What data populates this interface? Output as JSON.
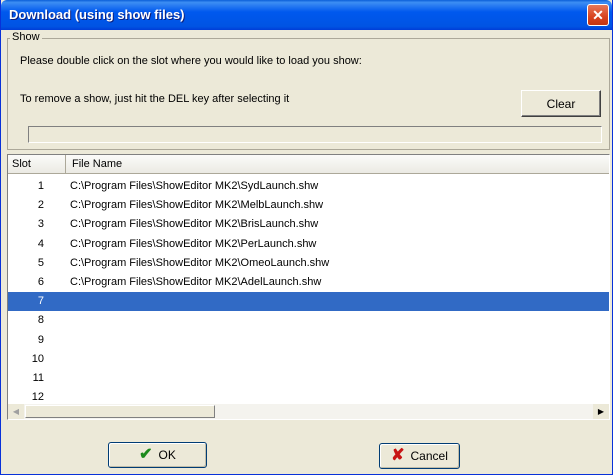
{
  "window": {
    "title": "Download (using show files)"
  },
  "show_group": {
    "legend": "Show",
    "instruction_load": "Please double click on the slot where you would like to load you show:",
    "instruction_remove": "To remove a show, just hit the DEL key after selecting it",
    "clear_label": "Clear"
  },
  "list": {
    "columns": {
      "slot": "Slot",
      "file": "File Name"
    },
    "rows": [
      {
        "slot": "1",
        "file": "C:\\Program Files\\ShowEditor MK2\\SydLaunch.shw"
      },
      {
        "slot": "2",
        "file": "C:\\Program Files\\ShowEditor MK2\\MelbLaunch.shw"
      },
      {
        "slot": "3",
        "file": "C:\\Program Files\\ShowEditor MK2\\BrisLaunch.shw"
      },
      {
        "slot": "4",
        "file": "C:\\Program Files\\ShowEditor MK2\\PerLaunch.shw"
      },
      {
        "slot": "5",
        "file": "C:\\Program Files\\ShowEditor MK2\\OmeoLaunch.shw"
      },
      {
        "slot": "6",
        "file": "C:\\Program Files\\ShowEditor MK2\\AdelLaunch.shw"
      },
      {
        "slot": "7",
        "file": ""
      },
      {
        "slot": "8",
        "file": ""
      },
      {
        "slot": "9",
        "file": ""
      },
      {
        "slot": "10",
        "file": ""
      },
      {
        "slot": "11",
        "file": ""
      },
      {
        "slot": "12",
        "file": ""
      }
    ],
    "selected_slot": "7"
  },
  "buttons": {
    "ok_label": "OK",
    "cancel_label": "Cancel"
  },
  "colors": {
    "selection": "#316ac5",
    "title_bar": "#0054e3"
  },
  "icons": {
    "close": "close-icon",
    "ok": "checkmark-icon",
    "cancel": "x-icon"
  }
}
